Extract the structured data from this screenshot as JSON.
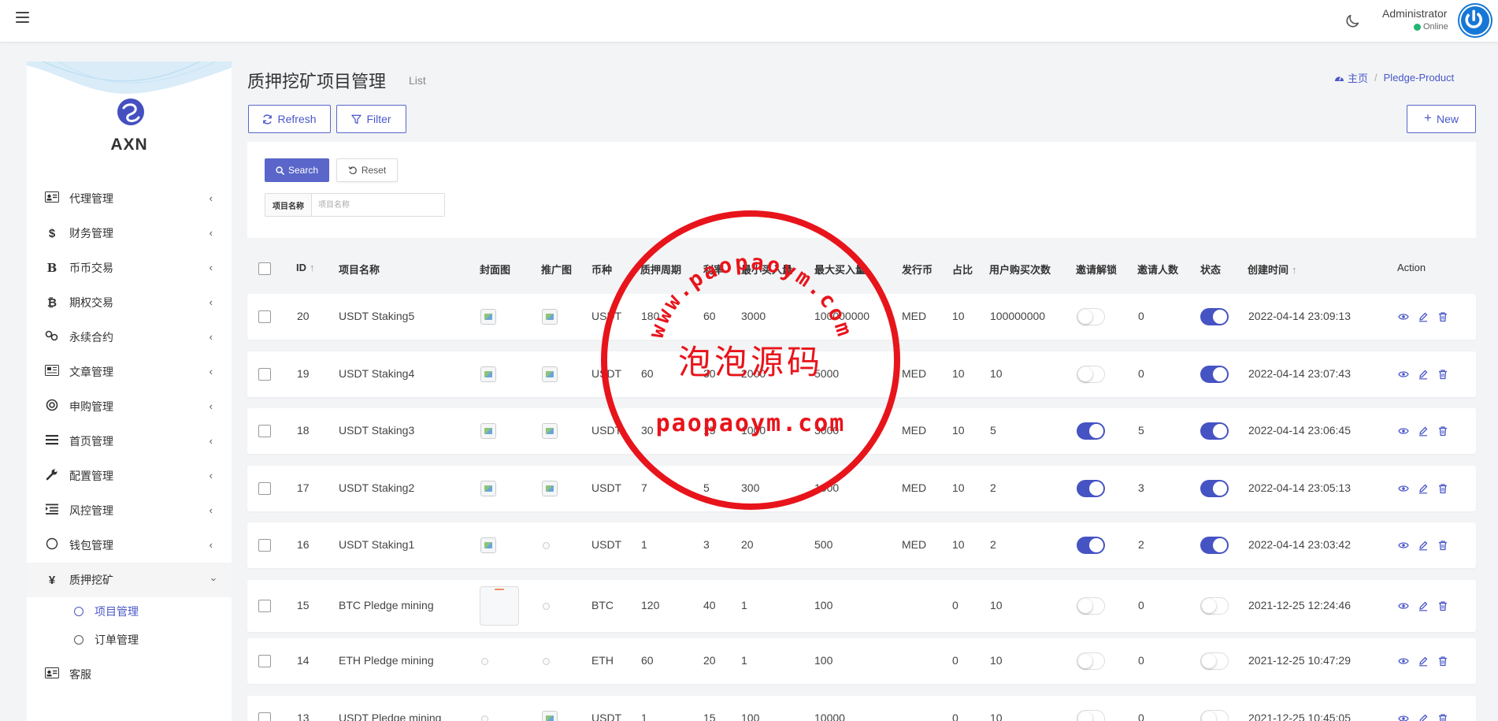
{
  "topbar": {
    "user_name": "Administrator",
    "user_status": "Online",
    "status_color": "#22b573"
  },
  "sidebar": {
    "logo_text": "AXN",
    "items": [
      {
        "label": "代理管理",
        "icon": "id-card-icon"
      },
      {
        "label": "财务管理",
        "icon": "dollar-icon"
      },
      {
        "label": "币币交易",
        "icon": "bitcoin-b-icon"
      },
      {
        "label": "期权交易",
        "icon": "bitcoin-icon"
      },
      {
        "label": "永续合约",
        "icon": "link-icon"
      },
      {
        "label": "文章管理",
        "icon": "newspaper-icon"
      },
      {
        "label": "申购管理",
        "icon": "lifebuoy-icon"
      },
      {
        "label": "首页管理",
        "icon": "bars-icon"
      },
      {
        "label": "配置管理",
        "icon": "wrench-icon"
      },
      {
        "label": "风控管理",
        "icon": "indent-icon"
      },
      {
        "label": "钱包管理",
        "icon": "circle-icon"
      },
      {
        "label": "质押挖矿",
        "icon": "yen-icon"
      }
    ],
    "sub_items": [
      {
        "label": "项目管理"
      },
      {
        "label": "订单管理"
      }
    ],
    "last_item": {
      "label": "客服",
      "icon": "id-card-icon"
    }
  },
  "page": {
    "title": "质押挖矿项目管理",
    "subtitle": "List",
    "breadcrumb_home": "主页",
    "breadcrumb_current": "Pledge-Product",
    "refresh_label": "Refresh",
    "filter_label": "Filter",
    "new_label": "New"
  },
  "filter": {
    "search_label": "Search",
    "reset_label": "Reset",
    "field_label": "项目名称",
    "field_placeholder": "项目名称"
  },
  "table": {
    "headers": {
      "id": "ID",
      "name": "项目名称",
      "cover": "封面图",
      "promo": "推广图",
      "currency": "币种",
      "period": "质押周期",
      "rate": "利率",
      "min_buy": "最小买入量",
      "max_buy": "最大买入量",
      "issue_coin": "发行币",
      "ratio": "占比",
      "buy_times": "用户购买次数",
      "invite_unlock": "邀请解锁",
      "invite_count": "邀请人数",
      "status": "状态",
      "created": "创建时间",
      "action": "Action"
    },
    "rows": [
      {
        "id": "20",
        "name": "USDT Staking5",
        "cover": "img",
        "promo": "img",
        "currency": "USDT",
        "period": "180",
        "rate": "60",
        "min_buy": "3000",
        "max_buy": "100000000",
        "issue_coin": "MED",
        "ratio": "10",
        "buy_times": "100000000",
        "invite_unlock": false,
        "invite_count": "0",
        "status": true,
        "created": "2022-04-14 23:09:13"
      },
      {
        "id": "19",
        "name": "USDT Staking4",
        "cover": "img",
        "promo": "img",
        "currency": "USDT",
        "period": "60",
        "rate": "30",
        "min_buy": "2000",
        "max_buy": "5000",
        "issue_coin": "MED",
        "ratio": "10",
        "buy_times": "10",
        "invite_unlock": false,
        "invite_count": "0",
        "status": true,
        "created": "2022-04-14 23:07:43"
      },
      {
        "id": "18",
        "name": "USDT Staking3",
        "cover": "img",
        "promo": "img",
        "currency": "USDT",
        "period": "30",
        "rate": "15",
        "min_buy": "1000",
        "max_buy": "3000",
        "issue_coin": "MED",
        "ratio": "10",
        "buy_times": "5",
        "invite_unlock": true,
        "invite_count": "5",
        "status": true,
        "created": "2022-04-14 23:06:45"
      },
      {
        "id": "17",
        "name": "USDT Staking2",
        "cover": "img",
        "promo": "img",
        "currency": "USDT",
        "period": "7",
        "rate": "5",
        "min_buy": "300",
        "max_buy": "1000",
        "issue_coin": "MED",
        "ratio": "10",
        "buy_times": "2",
        "invite_unlock": true,
        "invite_count": "3",
        "status": true,
        "created": "2022-04-14 23:05:13"
      },
      {
        "id": "16",
        "name": "USDT Staking1",
        "cover": "img",
        "promo": "dot",
        "currency": "USDT",
        "period": "1",
        "rate": "3",
        "min_buy": "20",
        "max_buy": "500",
        "issue_coin": "MED",
        "ratio": "10",
        "buy_times": "2",
        "invite_unlock": true,
        "invite_count": "2",
        "status": true,
        "created": "2022-04-14 23:03:42"
      },
      {
        "id": "15",
        "name": "BTC Pledge mining",
        "cover": "big",
        "promo": "dot",
        "currency": "BTC",
        "period": "120",
        "rate": "40",
        "min_buy": "1",
        "max_buy": "100",
        "issue_coin": "",
        "ratio": "0",
        "buy_times": "10",
        "invite_unlock": false,
        "invite_count": "0",
        "status": false,
        "created": "2021-12-25 12:24:46"
      },
      {
        "id": "14",
        "name": "ETH Pledge mining",
        "cover": "dot",
        "promo": "dot",
        "currency": "ETH",
        "period": "60",
        "rate": "20",
        "min_buy": "1",
        "max_buy": "100",
        "issue_coin": "",
        "ratio": "0",
        "buy_times": "10",
        "invite_unlock": false,
        "invite_count": "0",
        "status": false,
        "created": "2021-12-25 10:47:29"
      },
      {
        "id": "13",
        "name": "USDT Pledge mining",
        "cover": "dot",
        "promo": "img",
        "currency": "USDT",
        "period": "1",
        "rate": "15",
        "min_buy": "100",
        "max_buy": "10000",
        "issue_coin": "",
        "ratio": "0",
        "buy_times": "10",
        "invite_unlock": false,
        "invite_count": "0",
        "status": false,
        "created": "2021-12-25 10:45:05"
      }
    ]
  },
  "watermark": {
    "url_arc": "www.paopaoym.com",
    "cn_text": "泡泡源码",
    "domain_text": "paopaoym.com",
    "color": "#e8141b"
  },
  "colors": {
    "accent": "#4a57c8",
    "toggle_on": "#4653c3"
  }
}
